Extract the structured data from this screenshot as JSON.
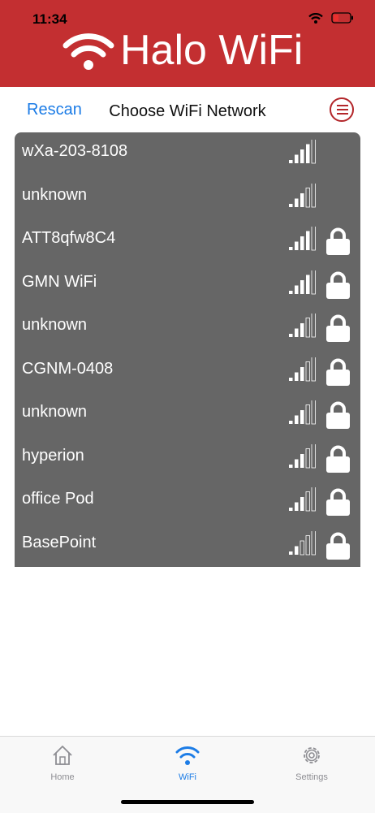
{
  "status_bar": {
    "time": "11:34"
  },
  "header": {
    "app_title": "Halo WiFi"
  },
  "toolbar": {
    "rescan_label": "Rescan",
    "title": "Choose WiFi Network"
  },
  "networks": [
    {
      "name": "wXa-203-8108",
      "signal_bars": 4,
      "locked": false
    },
    {
      "name": "unknown",
      "signal_bars": 3,
      "locked": false
    },
    {
      "name": "ATT8qfw8C4",
      "signal_bars": 4,
      "locked": true
    },
    {
      "name": "GMN WiFi",
      "signal_bars": 4,
      "locked": true
    },
    {
      "name": "unknown",
      "signal_bars": 3,
      "locked": true
    },
    {
      "name": "CGNM-0408",
      "signal_bars": 3,
      "locked": true
    },
    {
      "name": "unknown",
      "signal_bars": 3,
      "locked": true
    },
    {
      "name": "hyperion",
      "signal_bars": 3,
      "locked": true
    },
    {
      "name": "office Pod",
      "signal_bars": 3,
      "locked": true
    },
    {
      "name": "BasePoint",
      "signal_bars": 2,
      "locked": true
    }
  ],
  "tabs": [
    {
      "label": "Home",
      "icon": "home-icon",
      "active": false
    },
    {
      "label": "WiFi",
      "icon": "wifi-icon",
      "active": true
    },
    {
      "label": "Settings",
      "icon": "gear-icon",
      "active": false
    }
  ],
  "colors": {
    "header": "#c32f31",
    "accent": "#1c7ce6",
    "list_bg": "#666666"
  }
}
